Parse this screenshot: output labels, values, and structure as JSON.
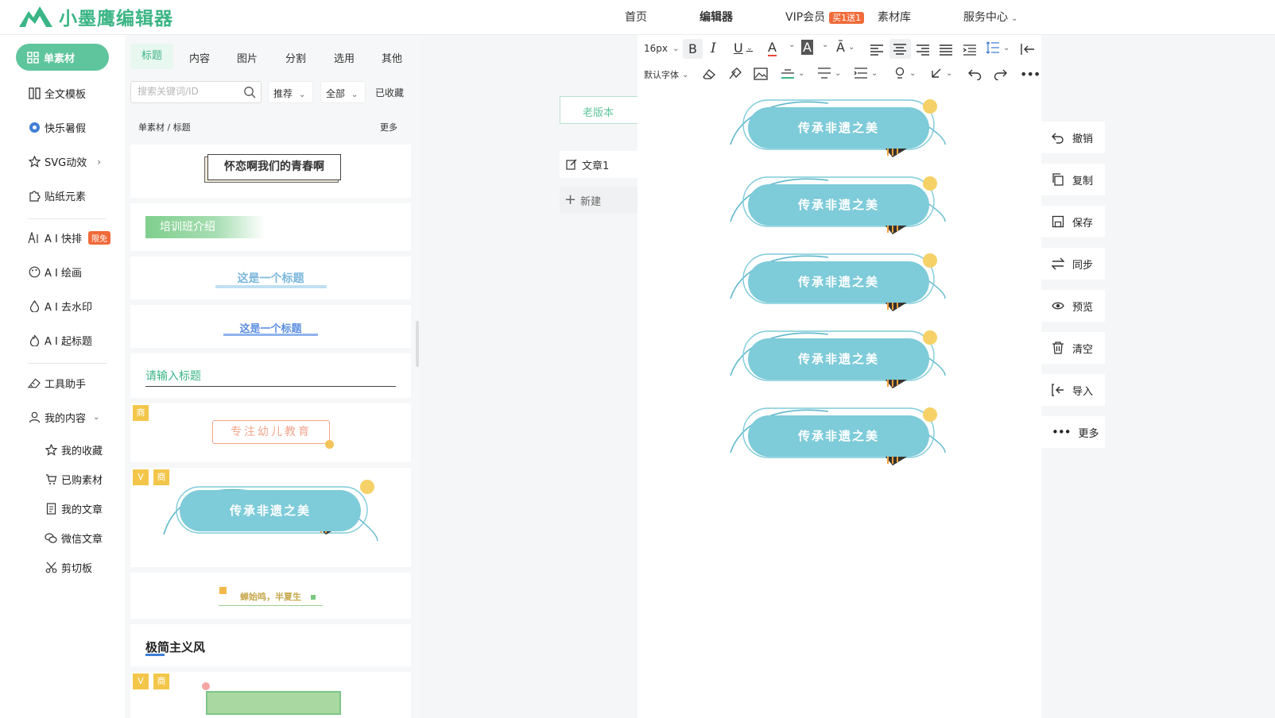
{
  "app": {
    "name": "小墨鹰编辑器",
    "brand_color": "#3bb586"
  },
  "topnav": {
    "items": [
      "首页",
      "编辑器",
      "VIP会员",
      "素材库",
      "服务中心"
    ],
    "vip_badge": "买1送1"
  },
  "sidebar": {
    "active": "单素材",
    "items": [
      "全文模板",
      "快乐暑假",
      "SVG动效",
      "贴纸元素",
      "A I 快排",
      "A I 绘画",
      "A I 去水印",
      "A I 起标题",
      "工具助手",
      "我的内容"
    ],
    "ai_badge": "限免",
    "sub_items": [
      "我的收藏",
      "已购素材",
      "我的文章",
      "微信文章",
      "剪切板"
    ]
  },
  "materials": {
    "tabs": [
      "标题",
      "内容",
      "图片",
      "分割",
      "选用",
      "其他"
    ],
    "search_placeholder": "搜索关键词/ID",
    "filters": [
      "推荐",
      "全部",
      "已收藏"
    ],
    "breadcrumb": "单素材 / 标题",
    "more": "更多",
    "cards": [
      "怀恋啊我们的青春啊",
      "培训班介绍",
      "这是一个标题",
      "这是一个标题",
      "请输入标题",
      "专注幼儿教育",
      "传承非遗之美",
      "蝉始鸣，半夏生",
      "极简主义风"
    ],
    "tag_v": "V",
    "tag_shang": "商"
  },
  "editor": {
    "old_version": "老版本",
    "doc_name": "文章1",
    "new_doc": "新建",
    "font_size": "16px",
    "font_family": "默认字体",
    "banners": [
      "传承非遗之美",
      "传承非遗之美",
      "传承非遗之美",
      "传承非遗之美",
      "传承非遗之美"
    ],
    "accent_banner": "#7ecbd9"
  },
  "actions": [
    "撤销",
    "复制",
    "保存",
    "同步",
    "预览",
    "清空",
    "导入",
    "更多"
  ]
}
